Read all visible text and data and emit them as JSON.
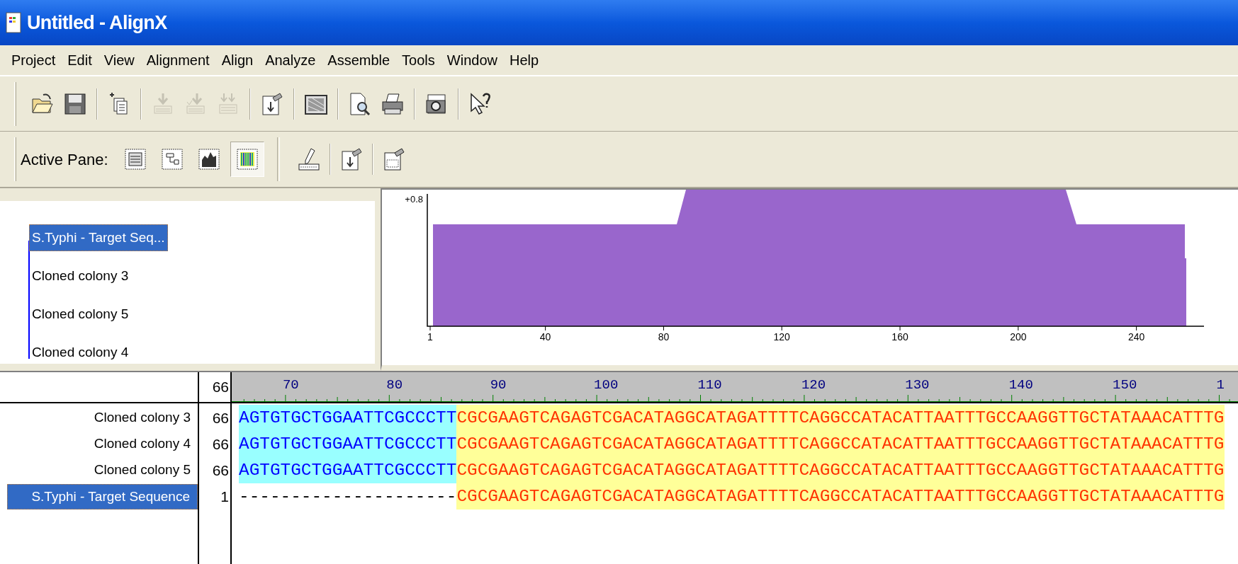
{
  "window": {
    "title": "Untitled - AlignX"
  },
  "menu": [
    "Project",
    "Edit",
    "View",
    "Alignment",
    "Align",
    "Analyze",
    "Assemble",
    "Tools",
    "Window",
    "Help"
  ],
  "toolbar": [
    {
      "kind": "open",
      "disabled": false
    },
    {
      "kind": "save",
      "disabled": false
    },
    {
      "kind": "add",
      "disabled": false
    },
    {
      "kind": "import",
      "disabled": true
    },
    {
      "kind": "import2",
      "disabled": true
    },
    {
      "kind": "import3",
      "disabled": true
    },
    {
      "kind": "export",
      "disabled": false
    },
    {
      "kind": "matrix",
      "disabled": false
    },
    {
      "kind": "preview",
      "disabled": false
    },
    {
      "kind": "print",
      "disabled": false
    },
    {
      "kind": "camera",
      "disabled": false
    },
    {
      "kind": "help",
      "disabled": false
    }
  ],
  "active_pane": {
    "label": "Active Pane:",
    "panes": [
      {
        "kind": "list",
        "selected": false
      },
      {
        "kind": "tree",
        "selected": false
      },
      {
        "kind": "plot",
        "selected": false
      },
      {
        "kind": "alignment",
        "selected": true
      }
    ]
  },
  "edit_tools": [
    {
      "kind": "edit"
    },
    {
      "kind": "export"
    },
    {
      "kind": "properties"
    }
  ],
  "tree": {
    "items": [
      {
        "label": "S.Typhi - Target Seq...",
        "selected": true
      },
      {
        "label": "Cloned colony 3",
        "selected": false
      },
      {
        "label": "Cloned colony 5",
        "selected": false
      },
      {
        "label": "Cloned colony 4",
        "selected": false
      }
    ]
  },
  "plot": {
    "y_label": "+0.8",
    "x_ticks": [
      "1",
      "40",
      "80",
      "120",
      "160",
      "200",
      "240"
    ]
  },
  "alignment": {
    "start": "66",
    "ruler": [
      "70",
      "80",
      "90",
      "100",
      "110",
      "120",
      "130",
      "140",
      "150",
      "1"
    ],
    "rows": [
      {
        "name": "Cloned colony 3",
        "start": "66",
        "selected": false,
        "segments": [
          {
            "kind": "vector",
            "text": "AGTGTGCTGGAATTCGCCCTT"
          },
          {
            "kind": "match",
            "text": "CGCGAAGTCAGAGTCGACATAGGCATAGATTTTCAGGCCATACATTAATTTGCCAAGGTTGCTATAAACATTTG"
          }
        ]
      },
      {
        "name": "Cloned colony 4",
        "start": "66",
        "selected": false,
        "segments": [
          {
            "kind": "vector",
            "text": "AGTGTGCTGGAATTCGCCCTT"
          },
          {
            "kind": "match",
            "text": "CGCGAAGTCAGAGTCGACATAGGCATAGATTTTCAGGCCATACATTAATTTGCCAAGGTTGCTATAAACATTTG"
          }
        ]
      },
      {
        "name": "Cloned colony 5",
        "start": "66",
        "selected": false,
        "segments": [
          {
            "kind": "vector",
            "text": "AGTGTGCTGGAATTCGCCCTT"
          },
          {
            "kind": "match",
            "text": "CGCGAAGTCAGAGTCGACATAGGCATAGATTTTCAGGCCATACATTAATTTGCCAAGGTTGCTATAAACATTTG"
          }
        ]
      },
      {
        "name": "S.Typhi - Target Sequence",
        "start": "1",
        "selected": true,
        "segments": [
          {
            "kind": "gap",
            "text": "---------------------"
          },
          {
            "kind": "match",
            "text": "CGCGAAGTCAGAGTCGACATAGGCATAGATTTTCAGGCCATACATTAATTTGCCAAGGTTGCTATAAACATTTG"
          }
        ]
      }
    ]
  }
}
